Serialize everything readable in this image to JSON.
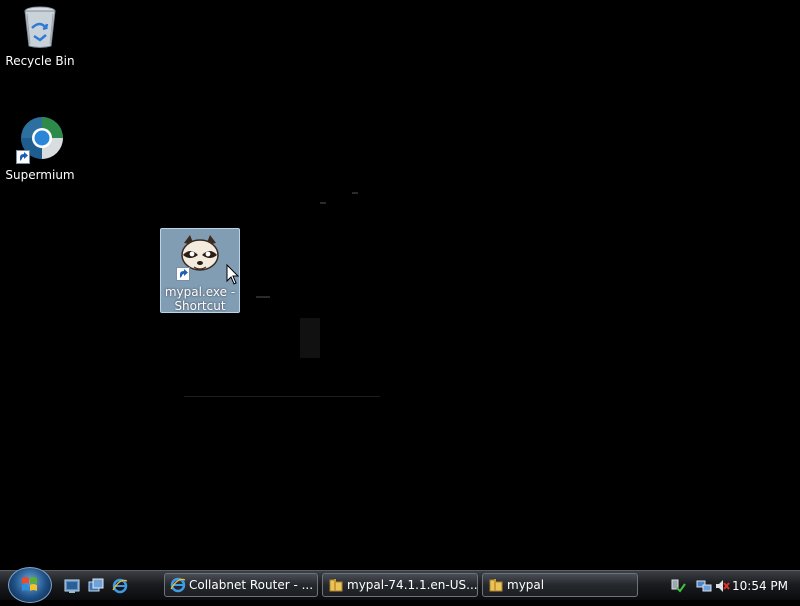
{
  "desktop": {
    "icons": [
      {
        "label": "Recycle Bin"
      },
      {
        "label": "Supermium"
      },
      {
        "label": "mypal.exe -\nShortcut"
      }
    ]
  },
  "taskbar": {
    "start_label": "Start",
    "quick_launch": [
      "show-desktop-icon",
      "switch-windows-icon",
      "internet-explorer-icon"
    ],
    "tasks": [
      {
        "label": "Collabnet Router - ...",
        "icon": "internet-explorer-icon"
      },
      {
        "label": "mypal-74.1.1.en-US....",
        "icon": "folder-icon"
      },
      {
        "label": "mypal",
        "icon": "folder-icon"
      }
    ],
    "tray": {
      "clock": "10:54 PM",
      "icons": [
        "safely-remove-hardware-icon",
        "network-icon",
        "volume-muted-icon"
      ]
    }
  },
  "colors": {
    "desktop_bg": "#000000",
    "selection_bg": "#96b9d2",
    "taskbar_bg": "#1a1c1f"
  }
}
